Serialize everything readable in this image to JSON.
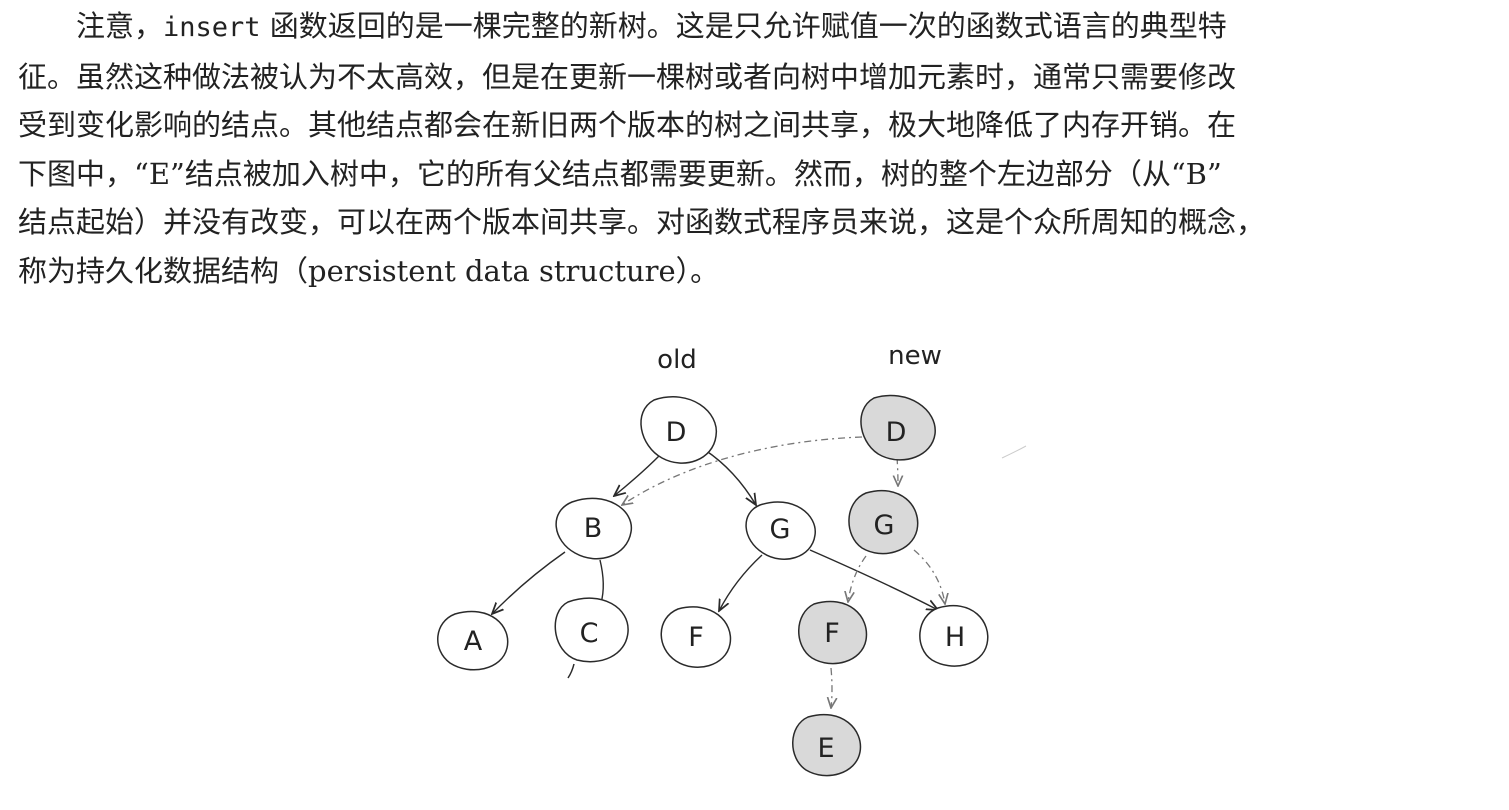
{
  "text": {
    "line1_a": "注意，",
    "line1_code": "insert",
    "line1_b": " 函数返回的是一棵完整的新树。这是只允许赋值一次的函数式语言的典型特",
    "line2": "征。虽然这种做法被认为不太高效，但是在更新一棵树或者向树中增加元素时，通常只需要修改",
    "line3": "受到变化影响的结点。其他结点都会在新旧两个版本的树之间共享，极大地降低了内存开销。在",
    "line4": "下图中，“E”结点被加入树中，它的所有父结点都需要更新。然而，树的整个左边部分（从“B”",
    "line5": "结点起始）并没有改变，可以在两个版本间共享。对函数式程序员来说，这是个众所周知的概念，",
    "line6": "称为持久化数据结构（persistent data structure）。"
  },
  "diagram": {
    "old_label": "old",
    "new_label": "new",
    "old_nodes": [
      "D",
      "B",
      "G",
      "A",
      "C",
      "F",
      "H"
    ],
    "new_nodes": [
      "D",
      "G",
      "F",
      "E"
    ],
    "colors": {
      "old_fill": "#ffffff",
      "new_fill": "#d9d9d9",
      "stroke": "#2a2a2a",
      "shared_edge": "#777777"
    }
  }
}
